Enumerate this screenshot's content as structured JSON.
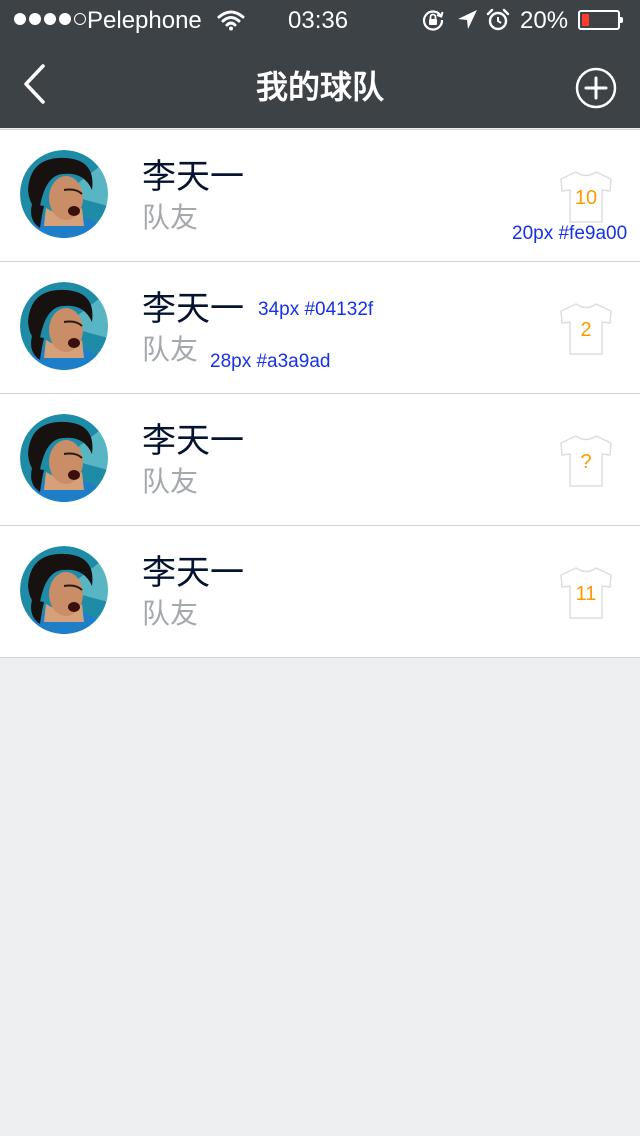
{
  "status_bar": {
    "carrier": "Pelephone",
    "time": "03:36",
    "battery_percent": "20%",
    "battery_level": 0.2,
    "signal_dots_filled": 4,
    "signal_dots_total": 5,
    "icons": [
      "wifi-icon",
      "rotation-lock-icon",
      "location-icon",
      "alarm-icon",
      "battery-icon"
    ]
  },
  "nav": {
    "title": "我的球队",
    "back_icon": "chevron-left-icon",
    "add_icon": "plus-circle-icon"
  },
  "members": [
    {
      "name": "李天一",
      "role": "队友",
      "number": "10"
    },
    {
      "name": "李天一",
      "role": "队友",
      "number": "2"
    },
    {
      "name": "李天一",
      "role": "队友",
      "number": "?"
    },
    {
      "name": "李天一",
      "role": "队友",
      "number": "11"
    }
  ],
  "annotations": {
    "number_style": "20px #fe9a00",
    "name_style": "34px #04132f",
    "role_style": "28px #a3a9ad"
  },
  "colors": {
    "header_bg": "#3d4247",
    "page_bg": "#eeeff1",
    "name_text": "#04132f",
    "role_text": "#a3a9ad",
    "number_text": "#fe9a00",
    "annotation_text": "#1632e8",
    "divider": "#d0d2d5",
    "battery_low": "#ff3b30"
  }
}
